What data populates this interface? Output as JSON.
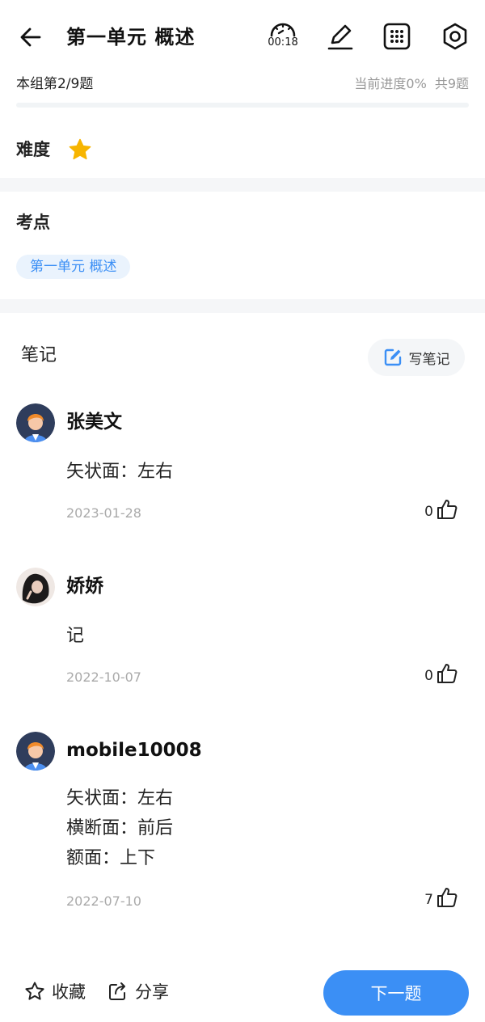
{
  "header": {
    "title": "第一单元 概述",
    "timer": "00:18",
    "icons": [
      "back-arrow-icon",
      "timer-icon",
      "pen-icon",
      "grid-icon",
      "settings-icon"
    ]
  },
  "progress": {
    "group_count": "本组第2/9题",
    "current_progress": "当前进度0%",
    "total": "共9题",
    "fraction": 0
  },
  "difficulty": {
    "label": "难度",
    "stars": 1
  },
  "kaodian": {
    "label": "考点",
    "tag": "第一单元 概述"
  },
  "notes": {
    "title": "笔记",
    "write_label": "写笔记",
    "items": [
      {
        "user": "张美文",
        "lines": [
          "矢状面：左右"
        ],
        "date": "2023-01-28",
        "likes": "0",
        "avatar": "default-avatar"
      },
      {
        "user": "娇娇",
        "lines": [
          "记"
        ],
        "date": "2022-10-07",
        "likes": "0",
        "avatar": "photo-avatar"
      },
      {
        "user": "mobile10008",
        "lines": [
          "矢状面：左右",
          "横断面：前后",
          "额面：上下"
        ],
        "date": "2022-07-10",
        "likes": "7",
        "avatar": "default-avatar"
      }
    ]
  },
  "footer": {
    "favorite_label": "收藏",
    "share_label": "分享",
    "next_label": "下一题"
  },
  "colors": {
    "accent": "#3b8ff5",
    "star": "#f7b500",
    "muted_text": "#999999",
    "tag_bg": "#eaf3fd"
  }
}
